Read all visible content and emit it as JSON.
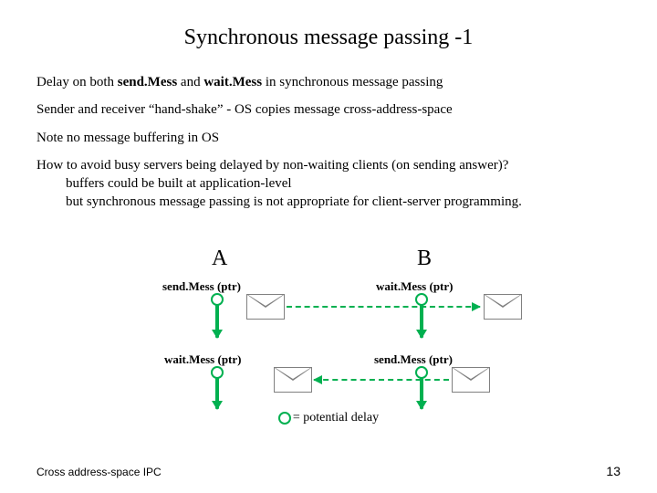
{
  "title": "Synchronous message passing -1",
  "body": {
    "p1_a": "Delay on both ",
    "p1_b": "send.Mess",
    "p1_c": " and ",
    "p1_d": "wait.Mess",
    "p1_e": " in synchronous message passing",
    "p2": "Sender and receiver “hand-shake”  - OS copies message cross-address-space",
    "p3": "Note no message buffering in OS",
    "p4a": "How to avoid busy servers being delayed by non-waiting clients (on sending answer)?",
    "p4b": "buffers could be built at application-level",
    "p4c": "but synchronous message passing is not appropriate for client-server programming."
  },
  "diagram": {
    "A": "A",
    "B": "B",
    "sendA": "send.Mess (ptr)",
    "waitA": "wait.Mess (ptr)",
    "waitB": "wait.Mess (ptr)",
    "sendB": "send.Mess (ptr)"
  },
  "legend_eq": "=",
  "legend_text": " potential delay",
  "footer_left": "Cross address-space IPC",
  "footer_right": "13"
}
